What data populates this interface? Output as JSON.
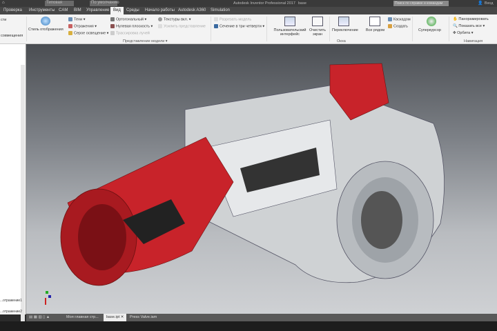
{
  "title": {
    "app": "Autodesk Inventor Professional 2017",
    "doc": "base",
    "qat_dropdown_1": "Типовая",
    "qat_dropdown_2": "По умолчанию",
    "search_placeholder": "Поиск по справке и командам",
    "signin": "Вход"
  },
  "tabs": [
    "Проверка",
    "Инструменты",
    "CAM",
    "BIM",
    "Управление",
    "Вид",
    "Среды",
    "Начало работы",
    "Autodesk A360",
    "Simulation"
  ],
  "active_tab": "Вид",
  "ribbon": {
    "left_cut": [
      "сти",
      "совмещения"
    ],
    "display_style": "Стиль отображения",
    "shadows": "Тени",
    "reflections": "Отражения",
    "lighting": "Серое освещение",
    "orthographic": "Ортогональный",
    "ground_plane": "Нулевая плоскость",
    "ray_tracing": "Трассировка лучей",
    "textures": "Текстуры вкл.",
    "enhance": "Усилить представление",
    "group_model": "Представление модели",
    "half_section": "Разрезать модель",
    "quarter_section": "Сечение в три четверти",
    "user_interface": "Пользовательский интерфейс",
    "clean_screen": "Очистить экран",
    "switch": "Переключение",
    "tile": "Все рядом",
    "cascade": "Каскадом",
    "new_window": "Создать",
    "group_windows": "Окна",
    "steering_wheel": "Суперкурсор",
    "pan": "Панорамировать",
    "zoom_all": "Показать все",
    "orbit": "Орбита",
    "group_nav": "Навигация"
  },
  "browser": {
    "items": [
      "...отражение1",
      "...отражение2"
    ]
  },
  "doc_tabs": [
    "Моя главная стр...",
    "base.ipt",
    "Press Valve.iam"
  ],
  "active_doc": "base.ipt",
  "colors": {
    "accent_red": "#c8232a",
    "body_grey": "#cfd2d4"
  }
}
